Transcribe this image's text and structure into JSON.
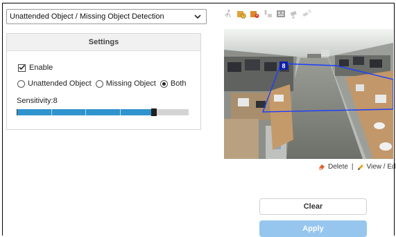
{
  "detection_mode": {
    "selected": "Unattended Object / Missing Object Detection"
  },
  "settings": {
    "title": "Settings",
    "enable_label": "Enable",
    "enable_checked": true,
    "modes": [
      {
        "label": "Unattended Object",
        "selected": false
      },
      {
        "label": "Missing Object",
        "selected": false
      },
      {
        "label": "Both",
        "selected": true
      }
    ],
    "sensitivity_label": "Sensitivity:8",
    "sensitivity_value": 8,
    "sensitivity_max": 10
  },
  "toolbar_icons": [
    "running-person-icon",
    "package-clock-icon",
    "package-alert-icon",
    "object-removed-icon",
    "camera-tamper-icon",
    "camera-moved-icon",
    "camera-blur-icon"
  ],
  "video": {
    "zone_label": "8"
  },
  "links": {
    "delete": "Delete",
    "separator": "|",
    "view_edit": "View / Edit"
  },
  "buttons": {
    "clear": "Clear",
    "apply": "Apply"
  },
  "colors": {
    "slider_fill": "#2f93cd",
    "apply_button": "#96c6ee",
    "zone_outline": "#1b3cff"
  }
}
